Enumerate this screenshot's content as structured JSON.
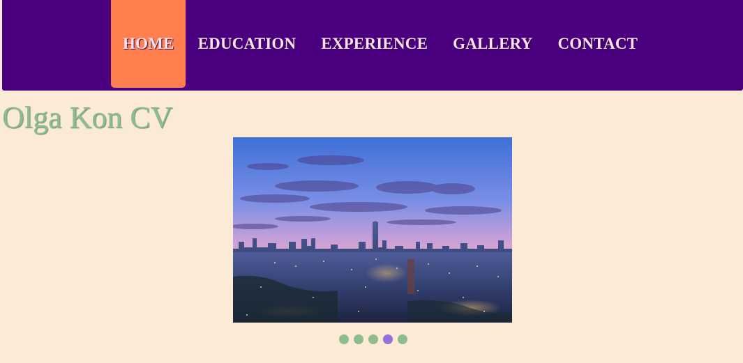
{
  "nav": {
    "items": [
      {
        "label": "HOME",
        "active": true
      },
      {
        "label": "EDUCATION",
        "active": false
      },
      {
        "label": "EXPERIENCE",
        "active": false
      },
      {
        "label": "GALLERY",
        "active": false
      },
      {
        "label": "CONTACT",
        "active": false
      }
    ]
  },
  "page": {
    "title": "Olga Kon CV"
  },
  "slideshow": {
    "slide_count": 5,
    "active_slide": 4
  },
  "colors": {
    "nav_bg": "#4b0080",
    "nav_active": "#ff7f4f",
    "page_bg": "#fbead6",
    "title": "#8fbc8f",
    "dot": "#8fbc8f",
    "dot_active": "#9370db"
  }
}
